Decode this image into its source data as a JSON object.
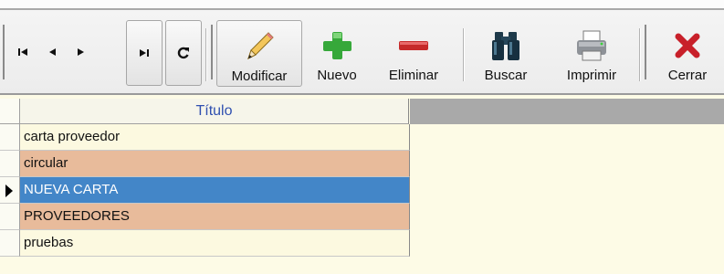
{
  "toolbar": {
    "nav": [
      {
        "name": "first-record-button",
        "icon": "first-icon"
      },
      {
        "name": "previous-record-button",
        "icon": "previous-icon"
      },
      {
        "name": "next-record-button",
        "icon": "next-icon"
      },
      {
        "name": "last-record-button",
        "icon": "last-icon"
      },
      {
        "name": "refresh-button",
        "icon": "refresh-icon"
      }
    ],
    "modificar_label": "Modificar",
    "nuevo_label": "Nuevo",
    "eliminar_label": "Eliminar",
    "buscar_label": "Buscar",
    "imprimir_label": "Imprimir",
    "cerrar_label": "Cerrar"
  },
  "grid": {
    "column_header": "Título",
    "rows": [
      {
        "titulo": "carta proveedor",
        "style": "normal"
      },
      {
        "titulo": "circular",
        "style": "alt"
      },
      {
        "titulo": "NUEVA CARTA",
        "style": "selected",
        "current": true
      },
      {
        "titulo": "PROVEEDORES",
        "style": "alt"
      },
      {
        "titulo": "pruebas",
        "style": "normal"
      }
    ]
  },
  "colors": {
    "selected_row": "#4386c8",
    "alt_row": "#e8bb9b",
    "normal_row": "#fcf9e0",
    "grid_background": "#fdfbe6",
    "header_text": "#3050b0"
  }
}
